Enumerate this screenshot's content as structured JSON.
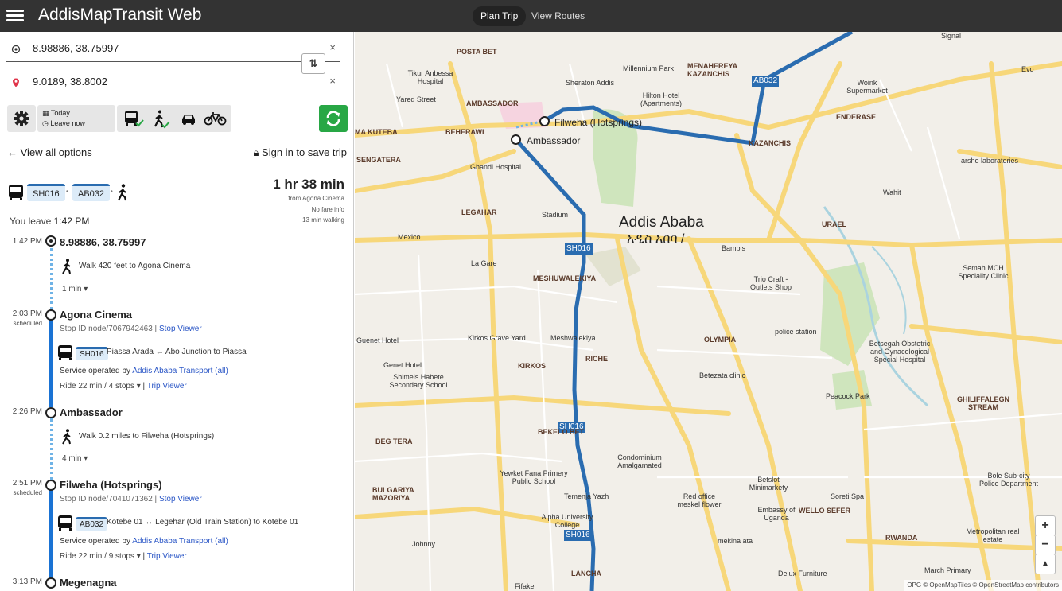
{
  "app": {
    "title": "AddisMapTransit Web"
  },
  "nav": {
    "tabs": [
      {
        "label": "Plan Trip"
      },
      {
        "label": "View Routes"
      }
    ]
  },
  "search": {
    "origin": "8.98886, 38.75997",
    "destination": "9.0189, 38.8002",
    "clear_glyph": "×",
    "swap_glyph": "⇅"
  },
  "options": {
    "when_day": "Today",
    "when_time": "Leave now",
    "modes": [
      "bus-icon",
      "walk-icon",
      "car-icon",
      "bike-icon"
    ]
  },
  "links": {
    "view_all": "View all options",
    "sign_in": "Sign in to save trip"
  },
  "itinerary": {
    "routes": [
      "SH016",
      "AB032"
    ],
    "duration": "1 hr 38 min",
    "from_text": "from Agona Cinema",
    "fare_text": "No fare info",
    "walking_text": "13 min walking",
    "leave_label": "You leave",
    "leave_time": "1:42 PM",
    "steps": [
      {
        "time": "1:42 PM",
        "name": "8.98886, 38.75997",
        "walk": "Walk 420 feet to Agona Cinema",
        "walk_time": "1 min"
      },
      {
        "time": "2:03 PM",
        "scheduled": "scheduled",
        "name": "Agona Cinema",
        "stop_id": "Stop ID node/7067942463 |",
        "stop_viewer": "Stop Viewer",
        "route": "SH016",
        "headsign": "Piassa Arada ↔ Abo Junction to Piassa",
        "operator_prefix": "Service operated by",
        "operator": "Addis Ababa Transport (all)",
        "ride": "Ride 22 min / 4 stops",
        "trip_viewer": "Trip Viewer"
      },
      {
        "time": "2:26 PM",
        "name": "Ambassador",
        "walk": "Walk 0.2 miles to Filweha (Hotsprings)",
        "walk_time": "4 min"
      },
      {
        "time": "2:51 PM",
        "scheduled": "scheduled",
        "name": "Filweha (Hotsprings)",
        "stop_id": "Stop ID node/7041071362 |",
        "stop_viewer": "Stop Viewer",
        "route": "AB032",
        "headsign": "Kotebe 01 ↔ Legehar (Old Train Station) to Kotebe 01",
        "operator_prefix": "Service operated by",
        "operator": "Addis Ababa Transport (all)",
        "ride": "Ride 22 min / 9 stops",
        "trip_viewer": "Trip Viewer"
      },
      {
        "time": "3:13 PM",
        "name": "Megenagna"
      }
    ]
  },
  "map": {
    "city": "Addis Ababa",
    "city_local": "አዲስ አበባ /",
    "stops": [
      "Filweha (Hotsprings)",
      "Ambassador"
    ],
    "route_tags": [
      "AB032",
      "SH016",
      "SH016",
      "SH016"
    ],
    "labels": {
      "posta_bet": "POSTA BET",
      "menahereya": "MENAHEREYA KAZANCHIS",
      "ambassador_area": "AMBASSADOR",
      "meskel_flower": "",
      "beherawi": "BEHERAWI",
      "kazanchis": "KAZANCHIS",
      "endarase": "ENDERASE",
      "sengatera": "SENGATERA",
      "legahar": "LEGAHAR",
      "urael": "URAEL",
      "meshuwalekiya": "MESHUWALEKIYA",
      "olympia": "OLYMPIA",
      "kirkos": "KIRKOS",
      "riche": "RICHE",
      "beg_tera": "BEG TERA",
      "bekelo_bet": "BEKELO BET",
      "bulgariya": "BULGARIYA MAZORIYA",
      "ghiliffalegn": "GHILIFFALEGN STREAM",
      "wello_sefer": "WELLO SEFER",
      "rwanda": "RWANDA",
      "lancha": "LANCHA",
      "kuteba": "MA KUTEBA",
      "stadium": "Stadium",
      "mexico": "Mexico",
      "bambis": "Bambis",
      "millennium": "Millennium Park",
      "sheraton": "Sheraton Addis",
      "hilton": "Hilton Hotel (Apartments)",
      "tikur": "Tikur Anbessa Hospital",
      "ghandi": "Ghandi Hospital",
      "yared": "Yared Street",
      "kirkos_grave": "Kirkos Grave Yard",
      "meshwalekiya": "Meshwalekiya",
      "genet": "Genet Hotel",
      "shimels": "Shimels Habete Secondary School",
      "condominium": "Condominium Amalgamated",
      "yewket": "Yewket Fana Primery Public School",
      "alpha": "Alpha University College",
      "temenja": "Temenja Yazh",
      "red_office": "Red office meskel flower",
      "embassy": "Embassy of Uganda",
      "betsegah": "Betsegah Obstetric and Gynacological Special Hospital",
      "peacock": "Peacock Park",
      "police": "police station",
      "betezata": "Betezata clinic",
      "trio": "Trio Craft - Outlets Shop",
      "semah": "Semah MCH Speciality Clinic",
      "bole_police": "Bole Sub-city Police Department",
      "metropolitan": "Metropolitan real estate",
      "woink": "Woink Supermarket",
      "guenet": "Guenet Hotel",
      "johnny": "Johnny",
      "fifake": "Fifake",
      "delux": "Delux Furniture",
      "march": "March Primary",
      "la_gare": "La Gare",
      "evo": "Evo",
      "signal": "Signal",
      "mekina": "mekina ata",
      "betslot": "Betslot Minimarkety",
      "soreti": "Soreti Spa",
      "arsho": "arsho laboratories",
      "wahit": "Wahit"
    },
    "zoom_in": "+",
    "zoom_out": "−",
    "compass": "▲",
    "attribution": "OPG © OpenMapTiles © OpenStreetMap contributors"
  },
  "colors": {
    "route": "#2a6cb0",
    "rail": "#1a73d4",
    "plan_button": "#28a745",
    "navbar": "#333333",
    "walk_dots": "#6fb3e6",
    "link": "#2a56c6"
  }
}
